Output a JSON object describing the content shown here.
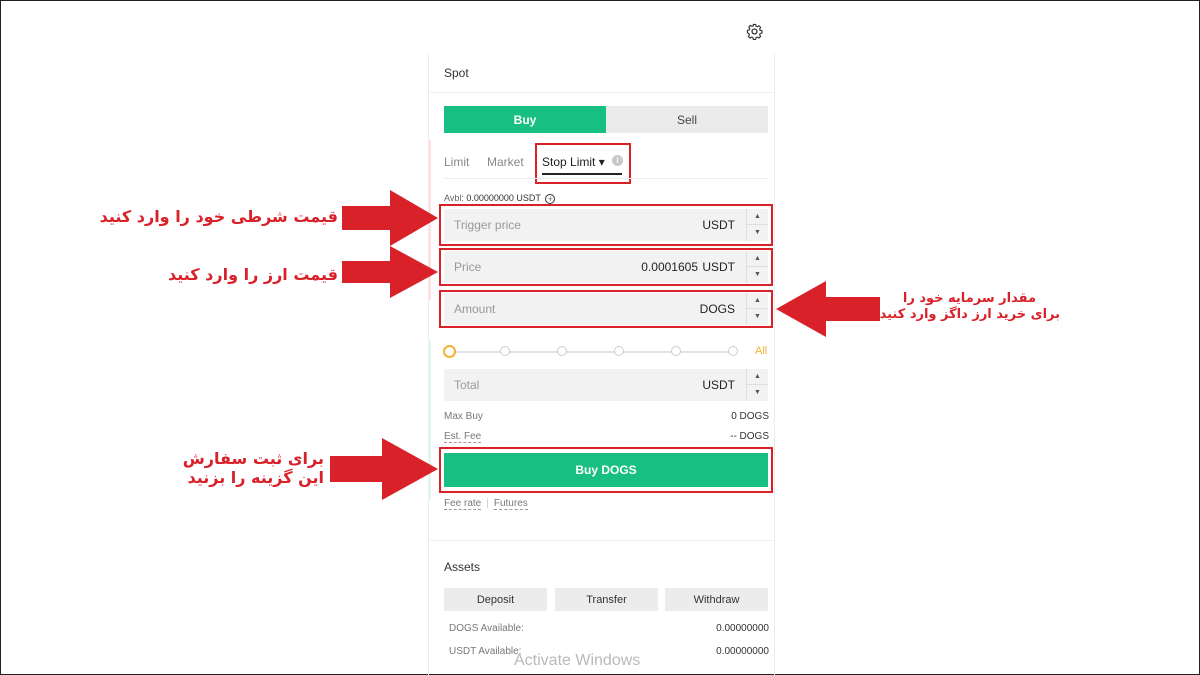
{
  "header": {
    "settings_icon": "gear-icon"
  },
  "panel": {
    "title": "Spot",
    "side_tabs": {
      "buy": "Buy",
      "sell": "Sell"
    },
    "order_tabs": [
      {
        "label": "Limit"
      },
      {
        "label": "Market"
      },
      {
        "label": "Stop Limit ▾",
        "active": true
      }
    ],
    "avbl": {
      "label": "Avbl:",
      "value": "0.00000000 USDT"
    },
    "fields": {
      "trigger": {
        "placeholder": "Trigger price",
        "value": "",
        "unit": "USDT"
      },
      "price": {
        "placeholder": "Price",
        "value": "0.0001605",
        "unit": "USDT"
      },
      "amount": {
        "placeholder": "Amount",
        "value": "",
        "unit": "DOGS"
      },
      "total": {
        "placeholder": "Total",
        "value": "",
        "unit": "USDT"
      }
    },
    "slider": {
      "all_label": "All",
      "percent": 0
    },
    "max_buy": {
      "label": "Max Buy",
      "value": "0 DOGS"
    },
    "est_fee": {
      "label": "Est. Fee",
      "value": "-- DOGS"
    },
    "buy_button": "Buy DOGS",
    "links": {
      "fee_rate": "Fee rate",
      "futures": "Futures"
    }
  },
  "assets": {
    "title": "Assets",
    "buttons": {
      "deposit": "Deposit",
      "transfer": "Transfer",
      "withdraw": "Withdraw"
    },
    "rows": [
      {
        "label": "DOGS Available:",
        "value": "0.00000000"
      },
      {
        "label": "USDT Available:",
        "value": "0.00000000"
      }
    ]
  },
  "watermark": "Activate Windows",
  "annotations": {
    "trigger": "قیمت شرطی خود را وارد کنید",
    "price": "قیمت ارز را وارد کنید",
    "amount_line1": "مقدار سرمایه خود را",
    "amount_line2": "برای خرید ارز داگز وارد کنید",
    "submit_line1": "برای ثبت سفارش",
    "submit_line2": "این گزینه را بزنید"
  },
  "colors": {
    "buy_green": "#17c082",
    "annotation_red": "#d82128",
    "slider_orange": "#f2b233"
  }
}
